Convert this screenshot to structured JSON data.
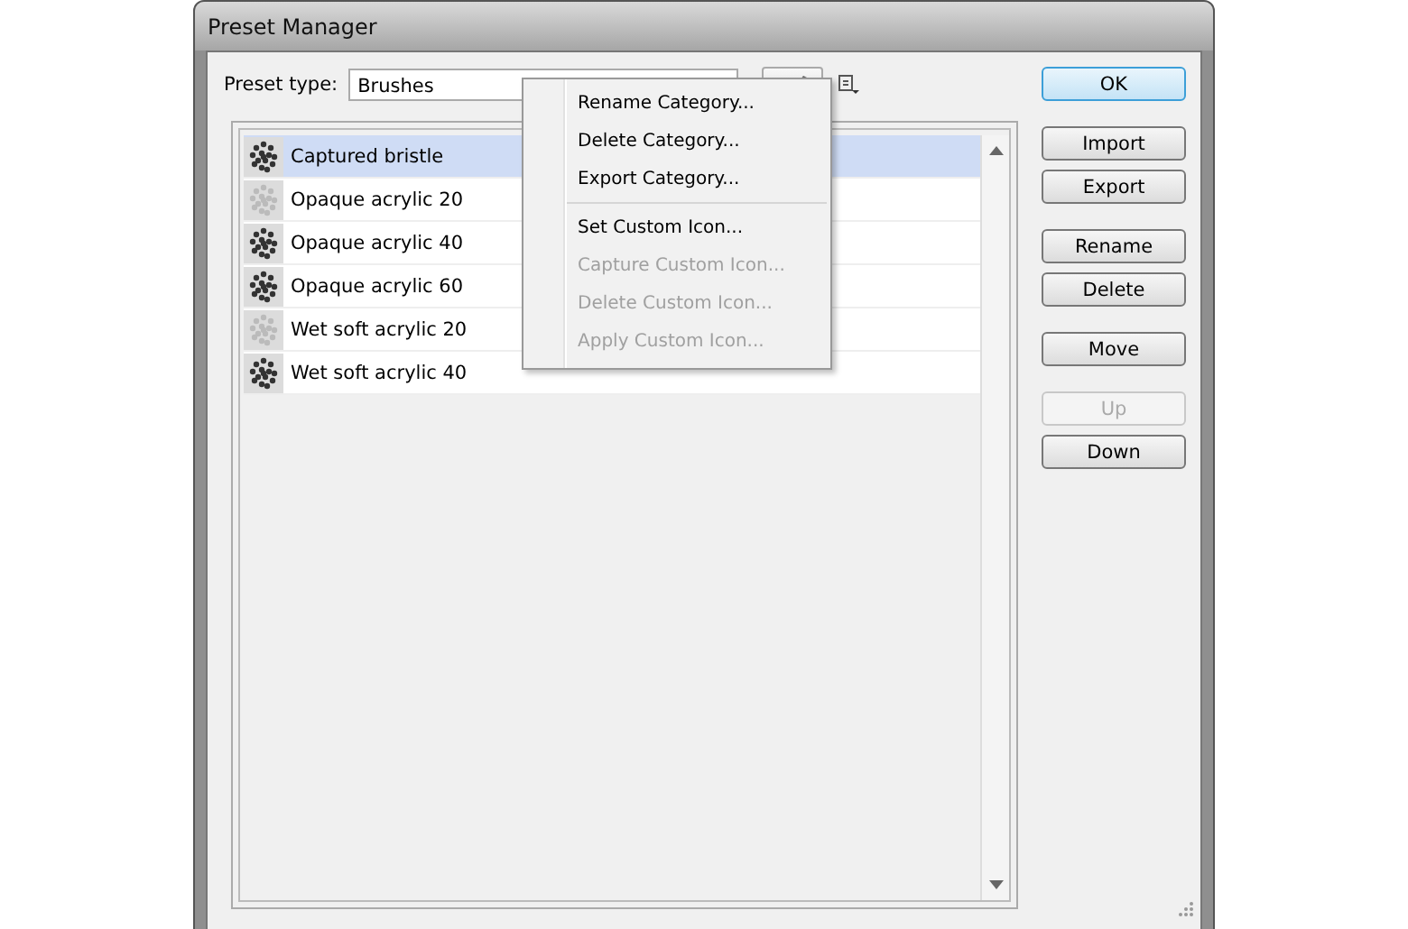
{
  "window": {
    "title": "Preset Manager"
  },
  "preset_type": {
    "label": "Preset type:",
    "value": "Brushes"
  },
  "presets": [
    {
      "name": "Captured bristle",
      "selected": true,
      "faded": false
    },
    {
      "name": "Opaque acrylic 20",
      "selected": false,
      "faded": true
    },
    {
      "name": "Opaque acrylic 40",
      "selected": false,
      "faded": false
    },
    {
      "name": "Opaque acrylic 60",
      "selected": false,
      "faded": false
    },
    {
      "name": "Wet soft acrylic 20",
      "selected": false,
      "faded": true
    },
    {
      "name": "Wet soft acrylic 40",
      "selected": false,
      "faded": false
    }
  ],
  "context_menu": {
    "groups": [
      [
        {
          "label": "Rename Category...",
          "disabled": false
        },
        {
          "label": "Delete Category...",
          "disabled": false
        },
        {
          "label": "Export Category...",
          "disabled": false
        }
      ],
      [
        {
          "label": "Set Custom Icon...",
          "disabled": false
        },
        {
          "label": "Capture Custom Icon...",
          "disabled": true
        },
        {
          "label": "Delete Custom Icon...",
          "disabled": true
        },
        {
          "label": "Apply Custom Icon...",
          "disabled": true
        }
      ]
    ]
  },
  "button_groups": [
    [
      {
        "label": "OK",
        "default": true,
        "disabled": false
      }
    ],
    [
      {
        "label": "Import",
        "default": false,
        "disabled": false
      },
      {
        "label": "Export",
        "default": false,
        "disabled": false
      }
    ],
    [
      {
        "label": "Rename",
        "default": false,
        "disabled": false
      },
      {
        "label": "Delete",
        "default": false,
        "disabled": false
      }
    ],
    [
      {
        "label": "Move",
        "default": false,
        "disabled": false
      }
    ],
    [
      {
        "label": "Up",
        "default": false,
        "disabled": true
      },
      {
        "label": "Down",
        "default": false,
        "disabled": false
      }
    ]
  ]
}
